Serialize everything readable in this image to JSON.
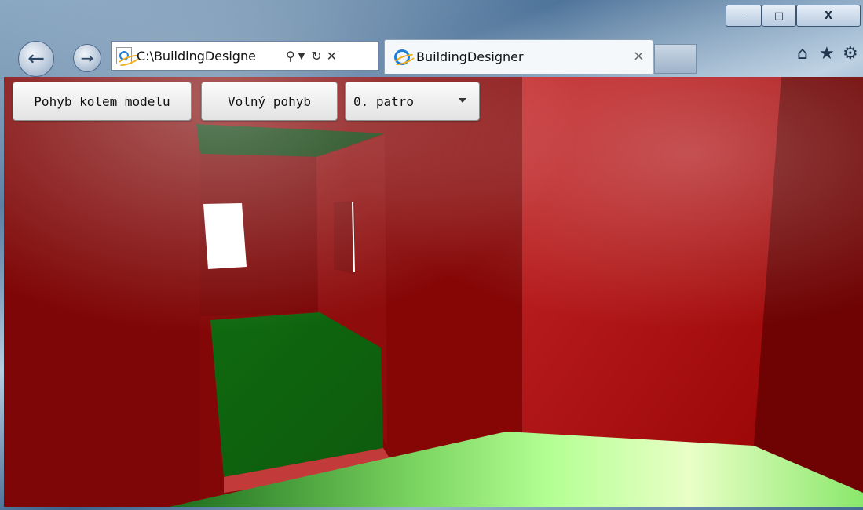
{
  "browser": {
    "address": "C:\\BuildingDesigne",
    "tab_title": "BuildingDesigner",
    "tab_close": "×",
    "window_controls": {
      "minimize": "–",
      "maximize": "□",
      "close": "X"
    },
    "icons": [
      "back-icon",
      "forward-icon",
      "ie-page-icon",
      "search-icon",
      "dropdown-icon",
      "refresh-icon",
      "stop-icon",
      "home-icon",
      "favorites-icon",
      "tools-icon"
    ]
  },
  "toolbar": {
    "orbit_label": "Pohyb kolem modelu",
    "free_label": "Volný pohyb",
    "floor_value": "0. patro"
  },
  "colors": {
    "wall_red": "#8b0a0a",
    "floor_green": "#a9f58c",
    "interior_floor": "#0f6a0f"
  }
}
